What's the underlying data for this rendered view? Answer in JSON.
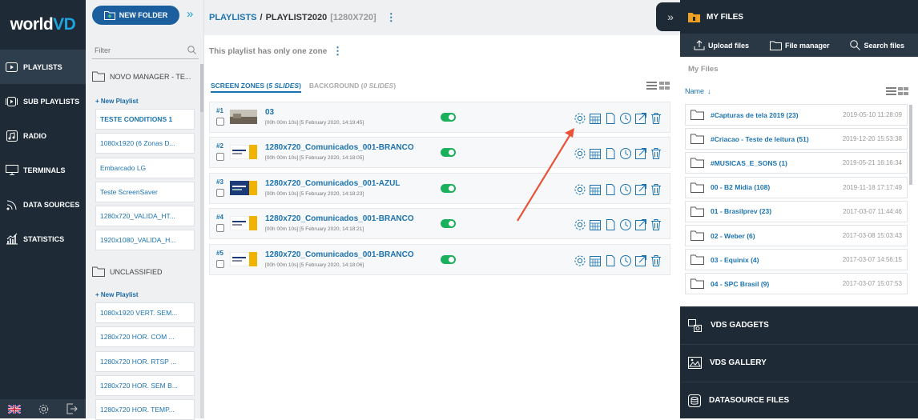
{
  "app": {
    "logo_main": "world",
    "logo_accent": "VD"
  },
  "nav": {
    "items": [
      {
        "label": "PLAYLISTS",
        "icon": "playlist-icon"
      },
      {
        "label": "SUB PLAYLISTS",
        "icon": "sub-playlist-icon"
      },
      {
        "label": "RADIO",
        "icon": "radio-icon"
      },
      {
        "label": "TERMINALS",
        "icon": "monitor-icon"
      },
      {
        "label": "DATA SOURCES",
        "icon": "rss-icon"
      },
      {
        "label": "STATISTICS",
        "icon": "bar-chart-icon"
      }
    ],
    "bottom_icons": [
      "uk-flag-icon",
      "gear-icon",
      "logout-icon"
    ]
  },
  "playlists_panel": {
    "new_folder_label": "NEW FOLDER",
    "filter_placeholder": "Filter",
    "folder1": {
      "name": "NOVO MANAGER - TE...",
      "new_playlist": "New Playlist",
      "items": [
        "TESTE CONDITIONS 1",
        "1080x1920 (6 Zonas D...",
        "Embarcado LG",
        "Teste ScreenSaver",
        "1280x720_VALIDA_HT...",
        "1920x1080_VALIDA_H..."
      ]
    },
    "folder2": {
      "name": "UNCLASSIFIED",
      "new_playlist": "New Playlist",
      "items": [
        "1080x1920 VERT. SEM...",
        "1280x720 HOR. COM ...",
        "1280x720 HOR. RTSP ...",
        "1280x720 HOR. SEM B...",
        "1280x720 HOR. TEMP..."
      ]
    }
  },
  "main": {
    "breadcrumb_root": "PLAYLISTS",
    "breadcrumb_sep": "/",
    "breadcrumb_current": "PLAYLIST2020",
    "breadcrumb_res": "[1280X720]",
    "zone_note": "This playlist has only one zone",
    "tab_zones_label": "SCREEN ZONES (",
    "tab_zones_count": "5 SLIDES",
    "tab_bg_label": "BACKGROUND (",
    "tab_bg_count": "0 SLIDES",
    "tab_close": ")",
    "slides": [
      {
        "num": "#1",
        "title": "03",
        "meta": "[00h 00m 10s] [5 February 2020, 14:19:45]",
        "enabled": true
      },
      {
        "num": "#2",
        "title": "1280x720_Comunicados_001-BRANCO",
        "meta": "[00h 00m 10s] [5 February 2020, 14:18:05]",
        "enabled": true
      },
      {
        "num": "#3",
        "title": "1280x720_Comunicados_001-AZUL",
        "meta": "[00h 00m 10s] [5 February 2020, 14:18:23]",
        "enabled": true
      },
      {
        "num": "#4",
        "title": "1280x720_Comunicados_001-BRANCO",
        "meta": "[00h 00m 10s] [5 February 2020, 14:18:21]",
        "enabled": true
      },
      {
        "num": "#5",
        "title": "1280x720_Comunicados_001-BRANCO",
        "meta": "[00h 00m 10s] [5 February 2020, 14:18:06]",
        "enabled": true
      }
    ]
  },
  "files": {
    "header": "MY FILES",
    "upload_label": "Upload files",
    "manager_label": "File manager",
    "search_label": "Search files",
    "panel_title": "My Files",
    "sort_label": "Name",
    "folders": [
      {
        "name": "#Capturas de tela 2019 (23)",
        "date": "2019-05-10 11:28:09"
      },
      {
        "name": "#Criacao - Teste de leitura (51)",
        "date": "2019-12-20 15:53:38"
      },
      {
        "name": "#MUSICAS_E_SONS (1)",
        "date": "2019-05-21 16:16:34"
      },
      {
        "name": "00 - B2 Midia (108)",
        "date": "2019-11-18 17:17:49"
      },
      {
        "name": "01 - Brasilprev (23)",
        "date": "2017-03-07 11:44:46"
      },
      {
        "name": "02 - Weber (6)",
        "date": "2017-03-08 15:03:43"
      },
      {
        "name": "03 - Equinix (4)",
        "date": "2017-03-07 14:56:15"
      },
      {
        "name": "04 - SPC Brasil (9)",
        "date": "2017-03-07 15:07:53"
      }
    ],
    "sections": [
      {
        "label": "VDS GADGETS",
        "icon": "gadgets-icon"
      },
      {
        "label": "VDS GALLERY",
        "icon": "gallery-icon"
      },
      {
        "label": "DATASOURCE FILES",
        "icon": "database-icon"
      }
    ]
  },
  "colors": {
    "accent": "#1c73b0",
    "nav_bg": "#1e2b37",
    "toggle_on": "#1bb05c",
    "annotation_arrow": "#e8533a"
  }
}
